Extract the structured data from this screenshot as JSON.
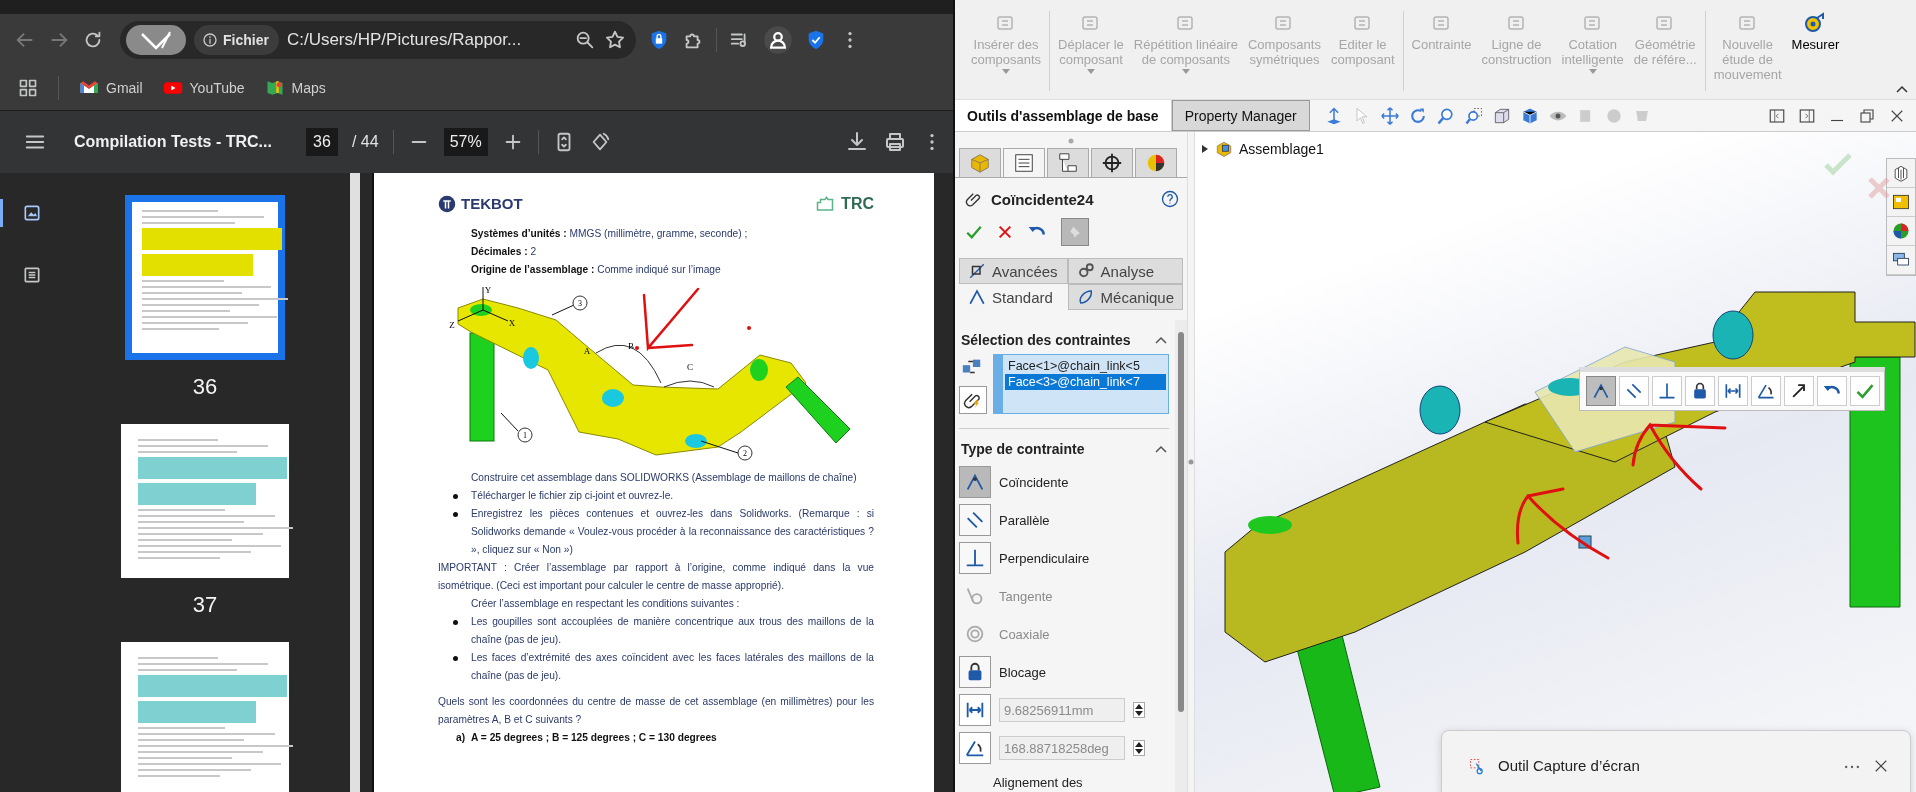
{
  "browser": {
    "address_bar": {
      "site_chip": "Fichier",
      "url": "C:/Users/HP/Pictures/Rappor..."
    },
    "bookmarks": [
      {
        "label": "Gmail"
      },
      {
        "label": "YouTube"
      },
      {
        "label": "Maps"
      }
    ]
  },
  "pdf_viewer": {
    "title": "Compilation Tests - TRC...",
    "page": "36",
    "page_total": "/ 44",
    "zoom": "57%",
    "side_rail": [
      {
        "kind": "thumbnails",
        "selected": true
      },
      {
        "kind": "outline",
        "selected": false
      }
    ],
    "thumbnails": [
      {
        "label": "36",
        "selected": true
      },
      {
        "label": "37",
        "selected": false
      },
      {
        "selected": false
      }
    ],
    "document": {
      "header": {
        "left_logo": "TEKBOT",
        "right_logo": "TRC"
      },
      "blocks": [
        {
          "kind": "indent",
          "text": "**Systèmes d’unités :** MMGS (millimètre, gramme, seconde) ;"
        },
        {
          "kind": "indent",
          "text": "**Décimales :** 2"
        },
        {
          "kind": "indent",
          "text": "**Origine de l’assemblage :** Comme indiqué sur l’image"
        },
        {
          "kind": "figure",
          "callouts": [
            "1",
            "2",
            "3"
          ],
          "angles": [
            "A",
            "B",
            "C"
          ],
          "axes": [
            "Y",
            "X",
            "Z"
          ]
        },
        {
          "kind": "indent",
          "text": "Construire cet assemblage dans SOLIDWORKS (Assemblage de maillons de chaîne)"
        },
        {
          "kind": "bullet",
          "text": "Télécharger le fichier zip ci-joint et ouvrez-le."
        },
        {
          "kind": "bullet",
          "text": "Enregistrez les pièces contenues et ouvrez-les dans Solidworks. (Remarque : si Solidworks demande « Voulez-vous procéder à la reconnaissance des caractéristiques ? », cliquez sur « Non »)"
        },
        {
          "kind": "para",
          "text": "IMPORTANT : Créer l’assemblage par rapport à l’origine, comme indiqué dans la vue isométrique. (Ceci est important pour calculer le centre de masse approprié)."
        },
        {
          "kind": "indent",
          "text": "Créer l’assemblage en respectant les conditions suivantes :"
        },
        {
          "kind": "bullet",
          "text": "Les goupilles sont accouplées de manière concentrique aux trous des maillons de la chaîne (pas de jeu)."
        },
        {
          "kind": "bullet",
          "text": "Les faces d’extrémité des axes coïncident avec les faces latérales des maillons de la chaîne (pas de jeu)."
        },
        {
          "kind": "para",
          "text": "Quels sont les coordonnées du centre de masse de cet assemblage (en millimètres) pour les paramètres A, B et C suivants ?"
        },
        {
          "kind": "item",
          "marker": "a)",
          "text": "A = 25 degrees ; B = 125 degrees ; C = 130 degrees"
        }
      ]
    }
  },
  "solidworks": {
    "ribbon": {
      "groups": [
        {
          "items": [
            {
              "label": "Insérer des\ncomposants",
              "disabled": true,
              "dropdown": true
            }
          ]
        },
        {
          "items": [
            {
              "label": "Déplacer le\ncomposant",
              "disabled": true,
              "dropdown": true
            },
            {
              "label": "Répétition linéaire\nde composants",
              "disabled": true,
              "dropdown": true
            },
            {
              "label": "Composants\nsymétriques",
              "disabled": true,
              "dropdown": false
            },
            {
              "label": "Editer le\ncomposant",
              "disabled": true,
              "dropdown": false
            }
          ]
        },
        {
          "items": [
            {
              "label": "Contrainte",
              "disabled": true,
              "dropdown": false
            },
            {
              "label": "Ligne de\nconstruction",
              "disabled": true,
              "dropdown": false
            },
            {
              "label": "Cotation\nintelligente",
              "disabled": true,
              "dropdown": true
            },
            {
              "label": "Géométrie\nde référe...",
              "disabled": true,
              "dropdown": false
            }
          ]
        },
        {
          "items": [
            {
              "label": "Nouvelle\nétude de\nmouvement",
              "disabled": true,
              "dropdown": false
            },
            {
              "label": "Mesurer",
              "disabled": false,
              "dropdown": false
            }
          ]
        }
      ]
    },
    "tabs": [
      {
        "label": "Outils d'assemblage de base",
        "selected": true
      },
      {
        "label": "Property Manager",
        "selected": false
      }
    ],
    "property_manager": {
      "tabs": [
        {
          "selected": false
        },
        {
          "selected": true
        },
        {
          "selected": false
        },
        {
          "selected": false
        },
        {
          "selected": false
        }
      ],
      "title": "Coïncidente24",
      "subtabs": [
        {
          "label": "Avancées",
          "selected": false
        },
        {
          "label": "Analyse",
          "selected": false
        },
        {
          "label": "Standard",
          "selected": true
        },
        {
          "label": "Mécanique",
          "selected": false
        }
      ],
      "selection": {
        "title": "Sélection des contraintes",
        "expanded": true,
        "entries": [
          {
            "text": "Face<1>@chain_link<5",
            "selected": false
          },
          {
            "text": "Face<3>@chain_link<7",
            "selected": true
          }
        ]
      },
      "types": {
        "title": "Type de contrainte",
        "expanded": true,
        "items": [
          {
            "label": "Coïncidente",
            "selected": true,
            "disabled": false
          },
          {
            "label": "Parallèle",
            "selected": false,
            "disabled": false
          },
          {
            "label": "Perpendiculaire",
            "selected": false,
            "disabled": false
          },
          {
            "label": "Tangente",
            "selected": false,
            "disabled": true
          },
          {
            "label": "Coaxiale",
            "selected": false,
            "disabled": true
          },
          {
            "label": "Blocage",
            "selected": false,
            "disabled": false
          }
        ],
        "fields": [
          {
            "value": "9.68256911mm",
            "disabled": true
          },
          {
            "value": "168.88718258deg",
            "disabled": true
          }
        ],
        "subheading": "Alignement des"
      }
    },
    "viewport": {
      "tree_root": "Assemblage1",
      "popup_toolbar": [
        {
          "selected": true
        },
        {
          "selected": false
        },
        {
          "selected": false
        },
        {
          "selected": false
        },
        {
          "selected": false
        },
        {
          "selected": false
        },
        {
          "selected": false
        },
        {
          "selected": false
        },
        {
          "selected": false
        }
      ],
      "notification": {
        "title": "Outil Capture d’écran"
      }
    }
  }
}
